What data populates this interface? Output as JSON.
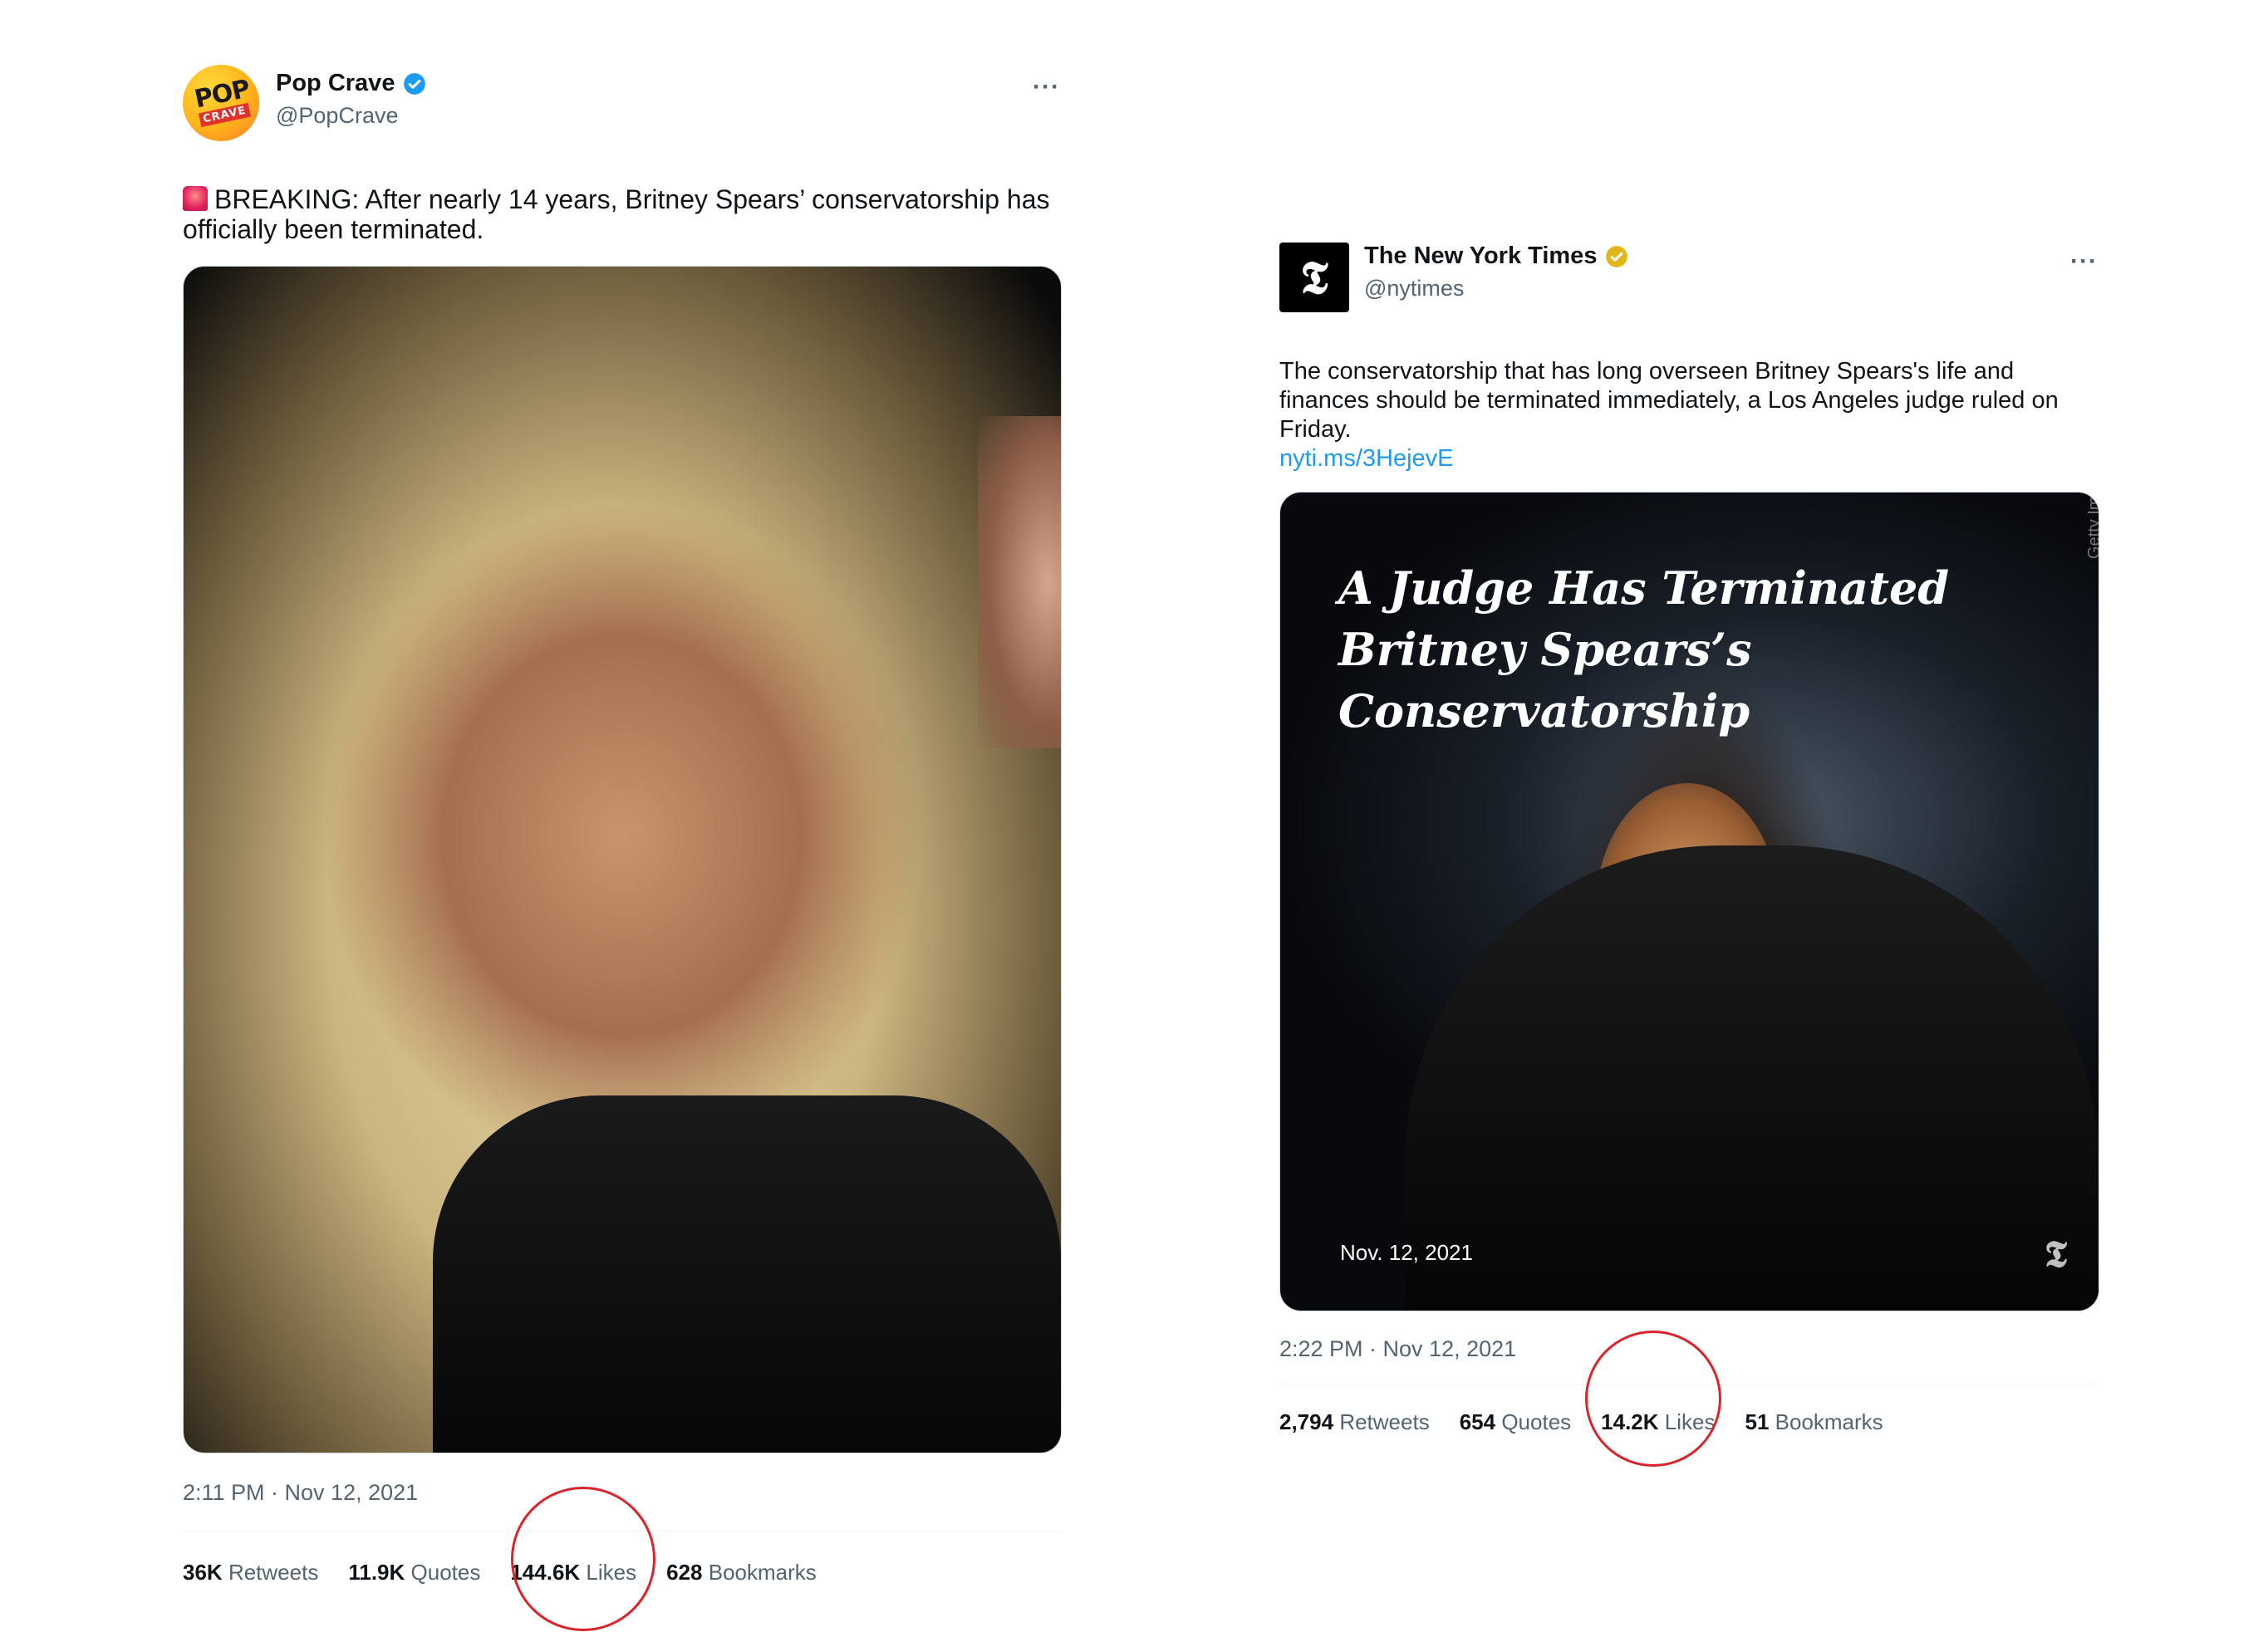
{
  "tweets": [
    {
      "author": "Pop Crave",
      "handle": "@PopCrave",
      "avatar": {
        "text_top": "POP",
        "text_bottom": "CRAVE"
      },
      "verified_color": "#1d9bf0",
      "more": "···",
      "text": "BREAKING: After nearly 14 years, Britney Spears’ conservatorship has officially been terminated.",
      "emoji_icon": "siren-icon",
      "timestamp": "2:11 PM · Nov 12, 2021",
      "stats": [
        {
          "value": "36K",
          "label": "Retweets"
        },
        {
          "value": "11.9K",
          "label": "Quotes"
        },
        {
          "value": "144.6K",
          "label": "Likes"
        },
        {
          "value": "628",
          "label": "Bookmarks"
        }
      ]
    },
    {
      "author": "The New York Times",
      "handle": "@nytimes",
      "avatar": {
        "text": "𝕿"
      },
      "verified_color": "#e2b719",
      "more": "···",
      "text": "The conservatorship that has long overseen Britney Spears's life and finances should be terminated immediately, a Los Angeles judge ruled on Friday.",
      "link": "nyti.ms/3HejevE",
      "image": {
        "headline_line1": "A Judge Has Terminated",
        "headline_line2": "Britney Spears’s Conservatorship",
        "credit": "Getty Images",
        "date": "Nov. 12, 2021",
        "logo": "𝕿"
      },
      "timestamp": "2:22 PM · Nov 12, 2021",
      "stats": [
        {
          "value": "2,794",
          "label": "Retweets"
        },
        {
          "value": "654",
          "label": "Quotes"
        },
        {
          "value": "14.2K",
          "label": "Likes"
        },
        {
          "value": "51",
          "label": "Bookmarks"
        }
      ]
    }
  ],
  "annotation_color": "#d8242a"
}
